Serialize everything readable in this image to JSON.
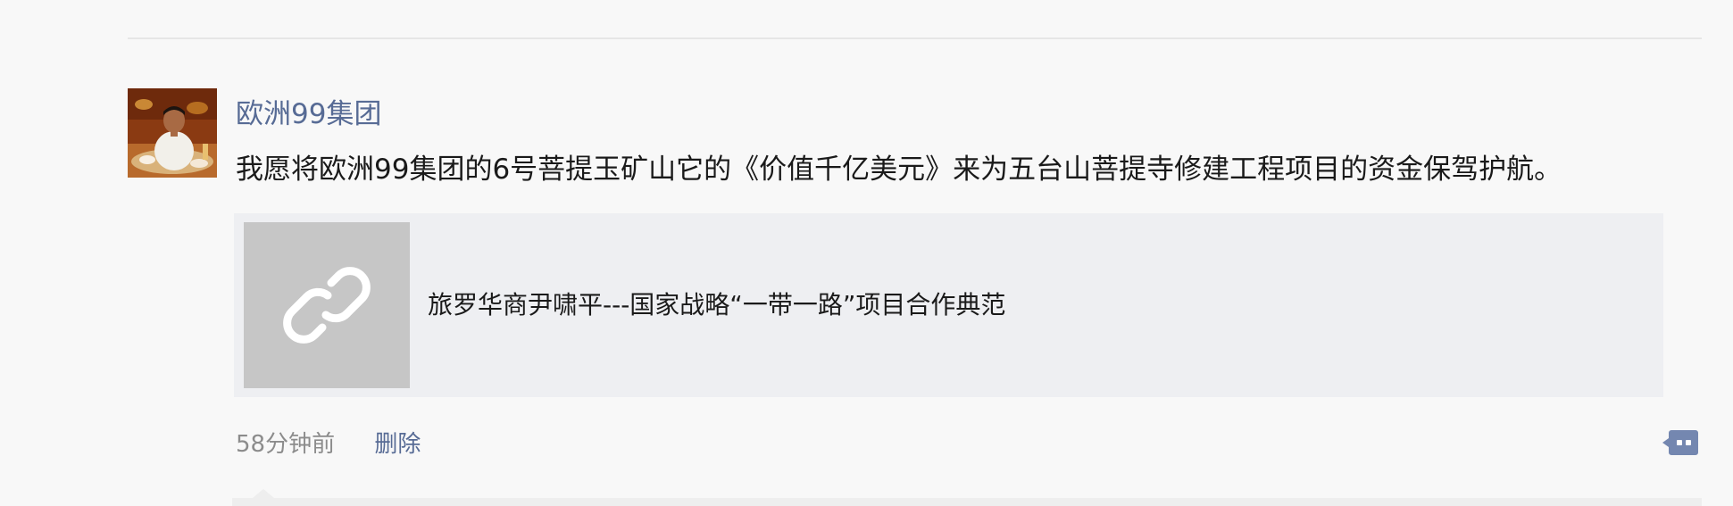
{
  "post": {
    "author": "欧洲99集团",
    "content": "我愿将欧洲99集团的6号菩提玉矿山它的《价值千亿美元》来为五台山菩提寺修建工程项目的资金保驾护航。",
    "link": {
      "title": "旅罗华商尹啸平---国家战略“一带一路”项目合作典范",
      "thumbnail_icon": "link-icon"
    },
    "timestamp": "58分钟前",
    "delete_label": "删除",
    "comment_icon": "comment-icon"
  },
  "colors": {
    "background": "#f8f8f8",
    "author_link": "#576b95",
    "card_background": "#eeeff2",
    "thumbnail_background": "#c6c6c6",
    "meta_gray": "#8c8c8c"
  }
}
